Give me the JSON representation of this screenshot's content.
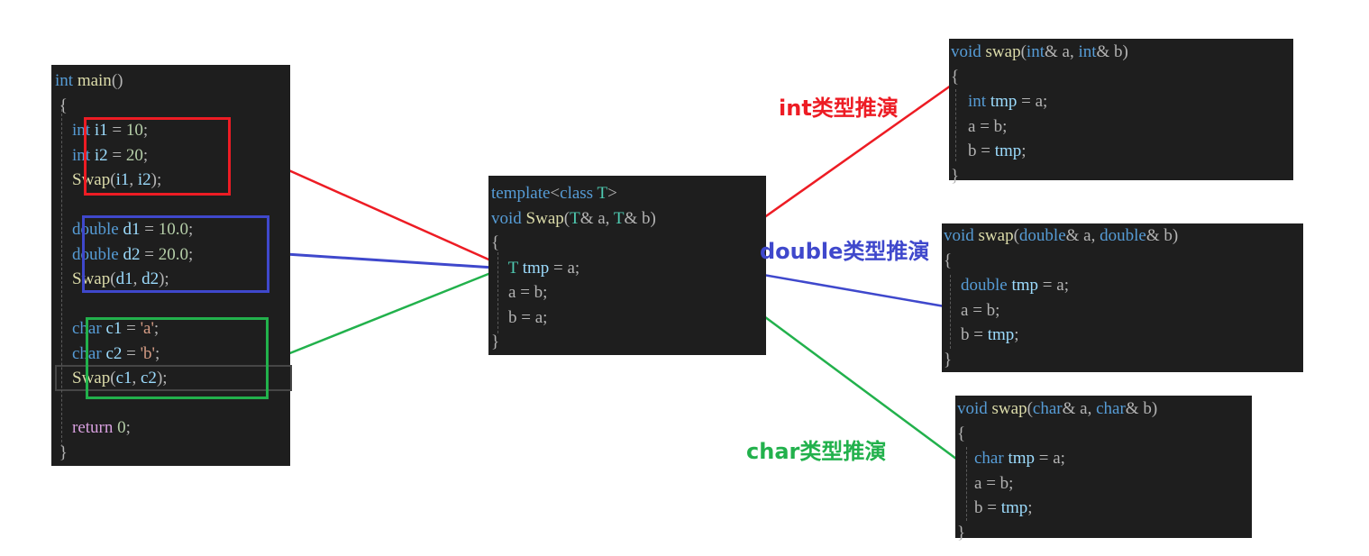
{
  "colors": {
    "int": "#ed1c24",
    "double": "#3f48cc",
    "char": "#22b14c"
  },
  "main_panel": {
    "lines": [
      [
        {
          "t": "int",
          "c": "kw"
        },
        {
          "t": " ",
          "c": "plain"
        },
        {
          "t": "main",
          "c": "fn"
        },
        {
          "t": "()",
          "c": "plain"
        }
      ],
      [
        {
          "t": " {",
          "c": "plain"
        }
      ],
      [
        {
          "t": "    ",
          "c": "plain"
        },
        {
          "t": "int",
          "c": "kw"
        },
        {
          "t": " ",
          "c": "plain"
        },
        {
          "t": "i1",
          "c": "var"
        },
        {
          "t": " = ",
          "c": "plain"
        },
        {
          "t": "10",
          "c": "num"
        },
        {
          "t": ";",
          "c": "plain"
        }
      ],
      [
        {
          "t": "    ",
          "c": "plain"
        },
        {
          "t": "int",
          "c": "kw"
        },
        {
          "t": " ",
          "c": "plain"
        },
        {
          "t": "i2",
          "c": "var"
        },
        {
          "t": " = ",
          "c": "plain"
        },
        {
          "t": "20",
          "c": "num"
        },
        {
          "t": ";",
          "c": "plain"
        }
      ],
      [
        {
          "t": "    ",
          "c": "plain"
        },
        {
          "t": "Swap",
          "c": "fn"
        },
        {
          "t": "(",
          "c": "plain"
        },
        {
          "t": "i1",
          "c": "var"
        },
        {
          "t": ", ",
          "c": "plain"
        },
        {
          "t": "i2",
          "c": "var"
        },
        {
          "t": ");",
          "c": "plain"
        }
      ],
      [
        {
          "t": "",
          "c": "plain"
        }
      ],
      [
        {
          "t": "    ",
          "c": "plain"
        },
        {
          "t": "double",
          "c": "kw"
        },
        {
          "t": " ",
          "c": "plain"
        },
        {
          "t": "d1",
          "c": "var"
        },
        {
          "t": " = ",
          "c": "plain"
        },
        {
          "t": "10.0",
          "c": "num"
        },
        {
          "t": ";",
          "c": "plain"
        }
      ],
      [
        {
          "t": "    ",
          "c": "plain"
        },
        {
          "t": "double",
          "c": "kw"
        },
        {
          "t": " ",
          "c": "plain"
        },
        {
          "t": "d2",
          "c": "var"
        },
        {
          "t": " = ",
          "c": "plain"
        },
        {
          "t": "20.0",
          "c": "num"
        },
        {
          "t": ";",
          "c": "plain"
        }
      ],
      [
        {
          "t": "    ",
          "c": "plain"
        },
        {
          "t": "Swap",
          "c": "fn"
        },
        {
          "t": "(",
          "c": "plain"
        },
        {
          "t": "d1",
          "c": "var"
        },
        {
          "t": ", ",
          "c": "plain"
        },
        {
          "t": "d2",
          "c": "var"
        },
        {
          "t": ");",
          "c": "plain"
        }
      ],
      [
        {
          "t": "",
          "c": "plain"
        }
      ],
      [
        {
          "t": "    ",
          "c": "plain"
        },
        {
          "t": "char",
          "c": "kw"
        },
        {
          "t": " ",
          "c": "plain"
        },
        {
          "t": "c1",
          "c": "var"
        },
        {
          "t": " = ",
          "c": "plain"
        },
        {
          "t": "'a'",
          "c": "str"
        },
        {
          "t": ";",
          "c": "plain"
        }
      ],
      [
        {
          "t": "    ",
          "c": "plain"
        },
        {
          "t": "char",
          "c": "kw"
        },
        {
          "t": " ",
          "c": "plain"
        },
        {
          "t": "c2",
          "c": "var"
        },
        {
          "t": " = ",
          "c": "plain"
        },
        {
          "t": "'b'",
          "c": "str"
        },
        {
          "t": ";",
          "c": "plain"
        }
      ],
      [
        {
          "t": "    ",
          "c": "plain"
        },
        {
          "t": "Swap",
          "c": "fn"
        },
        {
          "t": "(",
          "c": "plain"
        },
        {
          "t": "c1",
          "c": "var"
        },
        {
          "t": ", ",
          "c": "plain"
        },
        {
          "t": "c2",
          "c": "var"
        },
        {
          "t": ");",
          "c": "plain"
        }
      ],
      [
        {
          "t": "",
          "c": "plain"
        }
      ],
      [
        {
          "t": "    ",
          "c": "plain"
        },
        {
          "t": "return",
          "c": "ret"
        },
        {
          "t": " ",
          "c": "plain"
        },
        {
          "t": "0",
          "c": "num"
        },
        {
          "t": ";",
          "c": "plain"
        }
      ],
      [
        {
          "t": " }",
          "c": "plain"
        }
      ]
    ]
  },
  "template_panel": {
    "lines": [
      [
        {
          "t": "template",
          "c": "kw"
        },
        {
          "t": "<",
          "c": "plain"
        },
        {
          "t": "class",
          "c": "kw"
        },
        {
          "t": " ",
          "c": "plain"
        },
        {
          "t": "T",
          "c": "type"
        },
        {
          "t": ">",
          "c": "plain"
        }
      ],
      [
        {
          "t": "void",
          "c": "kw"
        },
        {
          "t": " ",
          "c": "plain"
        },
        {
          "t": "Swap",
          "c": "fn"
        },
        {
          "t": "(",
          "c": "plain"
        },
        {
          "t": "T",
          "c": "type"
        },
        {
          "t": "& ",
          "c": "plain"
        },
        {
          "t": "a",
          "c": "plain"
        },
        {
          "t": ", ",
          "c": "plain"
        },
        {
          "t": "T",
          "c": "type"
        },
        {
          "t": "& ",
          "c": "plain"
        },
        {
          "t": "b",
          "c": "plain"
        },
        {
          "t": ")",
          "c": "plain"
        }
      ],
      [
        {
          "t": "{",
          "c": "plain"
        }
      ],
      [
        {
          "t": "    ",
          "c": "plain"
        },
        {
          "t": "T",
          "c": "type"
        },
        {
          "t": " ",
          "c": "plain"
        },
        {
          "t": "tmp",
          "c": "var"
        },
        {
          "t": " = ",
          "c": "plain"
        },
        {
          "t": "a",
          "c": "plain"
        },
        {
          "t": ";",
          "c": "plain"
        }
      ],
      [
        {
          "t": "    ",
          "c": "plain"
        },
        {
          "t": "a",
          "c": "plain"
        },
        {
          "t": " = ",
          "c": "plain"
        },
        {
          "t": "b",
          "c": "plain"
        },
        {
          "t": ";",
          "c": "plain"
        }
      ],
      [
        {
          "t": "    ",
          "c": "plain"
        },
        {
          "t": "b",
          "c": "plain"
        },
        {
          "t": " = ",
          "c": "plain"
        },
        {
          "t": "a",
          "c": "plain"
        },
        {
          "t": ";",
          "c": "plain"
        }
      ],
      [
        {
          "t": "}",
          "c": "plain"
        }
      ]
    ]
  },
  "int_panel": {
    "label": "int类型推演",
    "lines": [
      [
        {
          "t": "void",
          "c": "kw"
        },
        {
          "t": " ",
          "c": "plain"
        },
        {
          "t": "swap",
          "c": "fn"
        },
        {
          "t": "(",
          "c": "plain"
        },
        {
          "t": "int",
          "c": "kw"
        },
        {
          "t": "& ",
          "c": "plain"
        },
        {
          "t": "a",
          "c": "plain"
        },
        {
          "t": ", ",
          "c": "plain"
        },
        {
          "t": "int",
          "c": "kw"
        },
        {
          "t": "& ",
          "c": "plain"
        },
        {
          "t": "b",
          "c": "plain"
        },
        {
          "t": ")",
          "c": "plain"
        }
      ],
      [
        {
          "t": "{",
          "c": "plain"
        }
      ],
      [
        {
          "t": "    ",
          "c": "plain"
        },
        {
          "t": "int",
          "c": "kw"
        },
        {
          "t": " ",
          "c": "plain"
        },
        {
          "t": "tmp",
          "c": "var"
        },
        {
          "t": " = ",
          "c": "plain"
        },
        {
          "t": "a",
          "c": "plain"
        },
        {
          "t": ";",
          "c": "plain"
        }
      ],
      [
        {
          "t": "    ",
          "c": "plain"
        },
        {
          "t": "a",
          "c": "plain"
        },
        {
          "t": " = ",
          "c": "plain"
        },
        {
          "t": "b",
          "c": "plain"
        },
        {
          "t": ";",
          "c": "plain"
        }
      ],
      [
        {
          "t": "    ",
          "c": "plain"
        },
        {
          "t": "b",
          "c": "plain"
        },
        {
          "t": " = ",
          "c": "plain"
        },
        {
          "t": "tmp",
          "c": "var"
        },
        {
          "t": ";",
          "c": "plain"
        }
      ],
      [
        {
          "t": "}",
          "c": "plain"
        }
      ]
    ]
  },
  "double_panel": {
    "label": "double类型推演",
    "lines": [
      [
        {
          "t": "void",
          "c": "kw"
        },
        {
          "t": " ",
          "c": "plain"
        },
        {
          "t": "swap",
          "c": "fn"
        },
        {
          "t": "(",
          "c": "plain"
        },
        {
          "t": "double",
          "c": "kw"
        },
        {
          "t": "& ",
          "c": "plain"
        },
        {
          "t": "a",
          "c": "plain"
        },
        {
          "t": ", ",
          "c": "plain"
        },
        {
          "t": "double",
          "c": "kw"
        },
        {
          "t": "& ",
          "c": "plain"
        },
        {
          "t": "b",
          "c": "plain"
        },
        {
          "t": ")",
          "c": "plain"
        }
      ],
      [
        {
          "t": "{",
          "c": "plain"
        }
      ],
      [
        {
          "t": "    ",
          "c": "plain"
        },
        {
          "t": "double",
          "c": "kw"
        },
        {
          "t": " ",
          "c": "plain"
        },
        {
          "t": "tmp",
          "c": "var"
        },
        {
          "t": " = ",
          "c": "plain"
        },
        {
          "t": "a",
          "c": "plain"
        },
        {
          "t": ";",
          "c": "plain"
        }
      ],
      [
        {
          "t": "    ",
          "c": "plain"
        },
        {
          "t": "a",
          "c": "plain"
        },
        {
          "t": " = ",
          "c": "plain"
        },
        {
          "t": "b",
          "c": "plain"
        },
        {
          "t": ";",
          "c": "plain"
        }
      ],
      [
        {
          "t": "    ",
          "c": "plain"
        },
        {
          "t": "b",
          "c": "plain"
        },
        {
          "t": " = ",
          "c": "plain"
        },
        {
          "t": "tmp",
          "c": "var"
        },
        {
          "t": ";",
          "c": "plain"
        }
      ],
      [
        {
          "t": "}",
          "c": "plain"
        }
      ]
    ]
  },
  "char_panel": {
    "label": "char类型推演",
    "lines": [
      [
        {
          "t": "void",
          "c": "kw"
        },
        {
          "t": " ",
          "c": "plain"
        },
        {
          "t": "swap",
          "c": "fn"
        },
        {
          "t": "(",
          "c": "plain"
        },
        {
          "t": "char",
          "c": "kw"
        },
        {
          "t": "& ",
          "c": "plain"
        },
        {
          "t": "a",
          "c": "plain"
        },
        {
          "t": ", ",
          "c": "plain"
        },
        {
          "t": "char",
          "c": "kw"
        },
        {
          "t": "& ",
          "c": "plain"
        },
        {
          "t": "b",
          "c": "plain"
        },
        {
          "t": ")",
          "c": "plain"
        }
      ],
      [
        {
          "t": "{",
          "c": "plain"
        }
      ],
      [
        {
          "t": "    ",
          "c": "plain"
        },
        {
          "t": "char",
          "c": "kw"
        },
        {
          "t": " ",
          "c": "plain"
        },
        {
          "t": "tmp",
          "c": "var"
        },
        {
          "t": " = ",
          "c": "plain"
        },
        {
          "t": "a",
          "c": "plain"
        },
        {
          "t": ";",
          "c": "plain"
        }
      ],
      [
        {
          "t": "    ",
          "c": "plain"
        },
        {
          "t": "a",
          "c": "plain"
        },
        {
          "t": " = ",
          "c": "plain"
        },
        {
          "t": "b",
          "c": "plain"
        },
        {
          "t": ";",
          "c": "plain"
        }
      ],
      [
        {
          "t": "    ",
          "c": "plain"
        },
        {
          "t": "b",
          "c": "plain"
        },
        {
          "t": " = ",
          "c": "plain"
        },
        {
          "t": "tmp",
          "c": "var"
        },
        {
          "t": ";",
          "c": "plain"
        }
      ],
      [
        {
          "t": "}",
          "c": "plain"
        }
      ]
    ]
  }
}
